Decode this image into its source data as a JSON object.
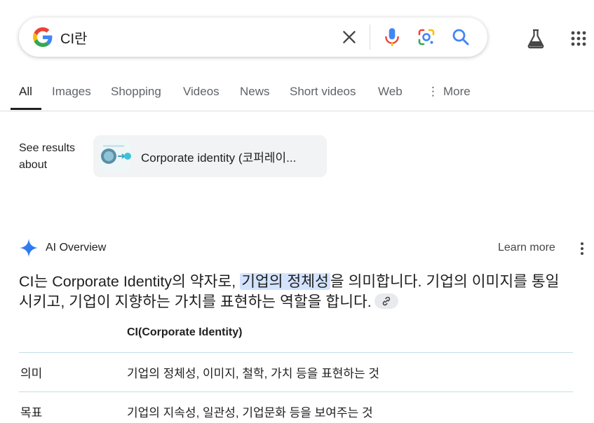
{
  "search": {
    "query": "CI란",
    "clear_label": "Clear",
    "mic_label": "Search by voice",
    "lens_label": "Search by image",
    "search_label": "Search"
  },
  "tabs": [
    {
      "label": "All",
      "active": true
    },
    {
      "label": "Images"
    },
    {
      "label": "Shopping"
    },
    {
      "label": "Videos"
    },
    {
      "label": "News"
    },
    {
      "label": "Short videos"
    },
    {
      "label": "Web"
    },
    {
      "label": "More"
    }
  ],
  "see_results": {
    "label": "See results about",
    "entity": "Corporate identity (코퍼레이..."
  },
  "ai_overview": {
    "title": "AI Overview",
    "learn_more": "Learn more",
    "text_before": "CI는 Corporate Identity의 약자로, ",
    "text_highlight": "기업의 정체성",
    "text_after": "을 의미합니다. 기업의 이미지를 통일시키고, 기업이 지향하는 가치를 표현하는 역할을 합니다.",
    "table": {
      "header": "CI(Corporate Identity)",
      "rows": [
        {
          "key": "의미",
          "value": "기업의 정체성, 이미지, 철학, 가치 등을 표현하는 것"
        },
        {
          "key": "목표",
          "value": "기업의 지속성, 일관성, 기업문화 등을 보여주는 것"
        }
      ]
    }
  },
  "icons": {
    "google_logo": "google-g-icon",
    "clear": "close-icon",
    "mic": "microphone-icon",
    "lens": "google-lens-icon",
    "search": "search-icon",
    "labs": "flask-icon",
    "apps": "apps-grid-icon",
    "ai": "sparkle-icon",
    "more": "more-vert-icon",
    "link": "link-icon"
  },
  "colors": {
    "google_blue": "#4285F4",
    "google_red": "#EA4335",
    "google_yellow": "#FBBC05",
    "google_green": "#34A853",
    "highlight": "#d3e3fd",
    "text": "#1f1f1f",
    "muted": "#5f6368"
  }
}
